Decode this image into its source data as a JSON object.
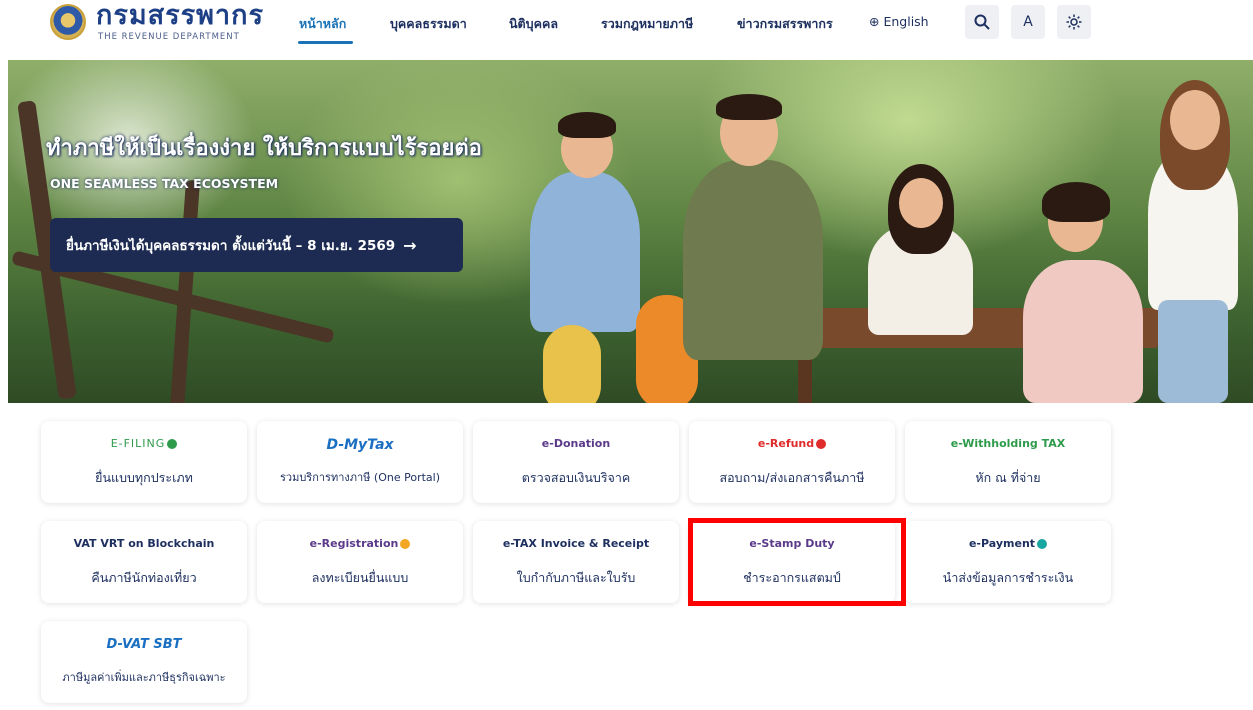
{
  "header": {
    "logo_th": "กรมสรรพากร",
    "logo_en": "THE REVENUE DEPARTMENT",
    "nav": [
      {
        "label": "หน้าหลัก",
        "active": true
      },
      {
        "label": "บุคคลธรรมดา",
        "active": false
      },
      {
        "label": "นิติบุคคล",
        "active": false
      },
      {
        "label": "รวมกฎหมายภาษี",
        "active": false
      },
      {
        "label": "ข่าวกรมสรรพากร",
        "active": false
      }
    ],
    "language": "English",
    "font_size_button": "A",
    "icons": [
      "globe-icon",
      "search-icon",
      "sun-icon"
    ]
  },
  "hero": {
    "title": "ทำภาษีให้เป็นเรื่องง่าย ให้บริการแบบไร้รอยต่อ",
    "subtitle": "ONE SEAMLESS TAX ECOSYSTEM",
    "cta": "ยื่นภาษีเงินได้บุคคลธรรมดา ตั้งแต่วันนี้ – 8 เม.ย. 2569",
    "cta_arrow": "→"
  },
  "services": [
    {
      "logo": "E-FILING",
      "label": "ยื่นแบบทุกประเภท"
    },
    {
      "logo": "D-MyTax",
      "label": "รวมบริการทางภาษี (One Portal)"
    },
    {
      "logo": "e-Donation",
      "label": "ตรวจสอบเงินบริจาค"
    },
    {
      "logo": "e-Refund",
      "label": "สอบถาม/ส่งเอกสารคืนภาษี"
    },
    {
      "logo": "e-Withholding TAX",
      "label": "หัก ณ ที่จ่าย"
    },
    {
      "logo": "VAT VRT on Blockchain",
      "label": "คืนภาษีนักท่องเที่ยว"
    },
    {
      "logo": "e-Registration",
      "label": "ลงทะเบียนยื่นแบบ"
    },
    {
      "logo": "e-TAX Invoice & Receipt",
      "label": "ใบกำกับภาษีและใบรับ"
    },
    {
      "logo": "e-Stamp Duty",
      "label": "ชำระอากรแสตมป์"
    },
    {
      "logo": "e-Payment",
      "label": "นำส่งข้อมูลการชำระเงิน"
    },
    {
      "logo": "D-VAT SBT",
      "label": "ภาษีมูลค่าเพิ่มและภาษีธุรกิจเฉพาะ"
    }
  ],
  "colors": {
    "primary": "#1d2f5f",
    "accent": "#1a73b6",
    "cta_bg": "#1d2b52",
    "highlight": "#ff0000"
  }
}
